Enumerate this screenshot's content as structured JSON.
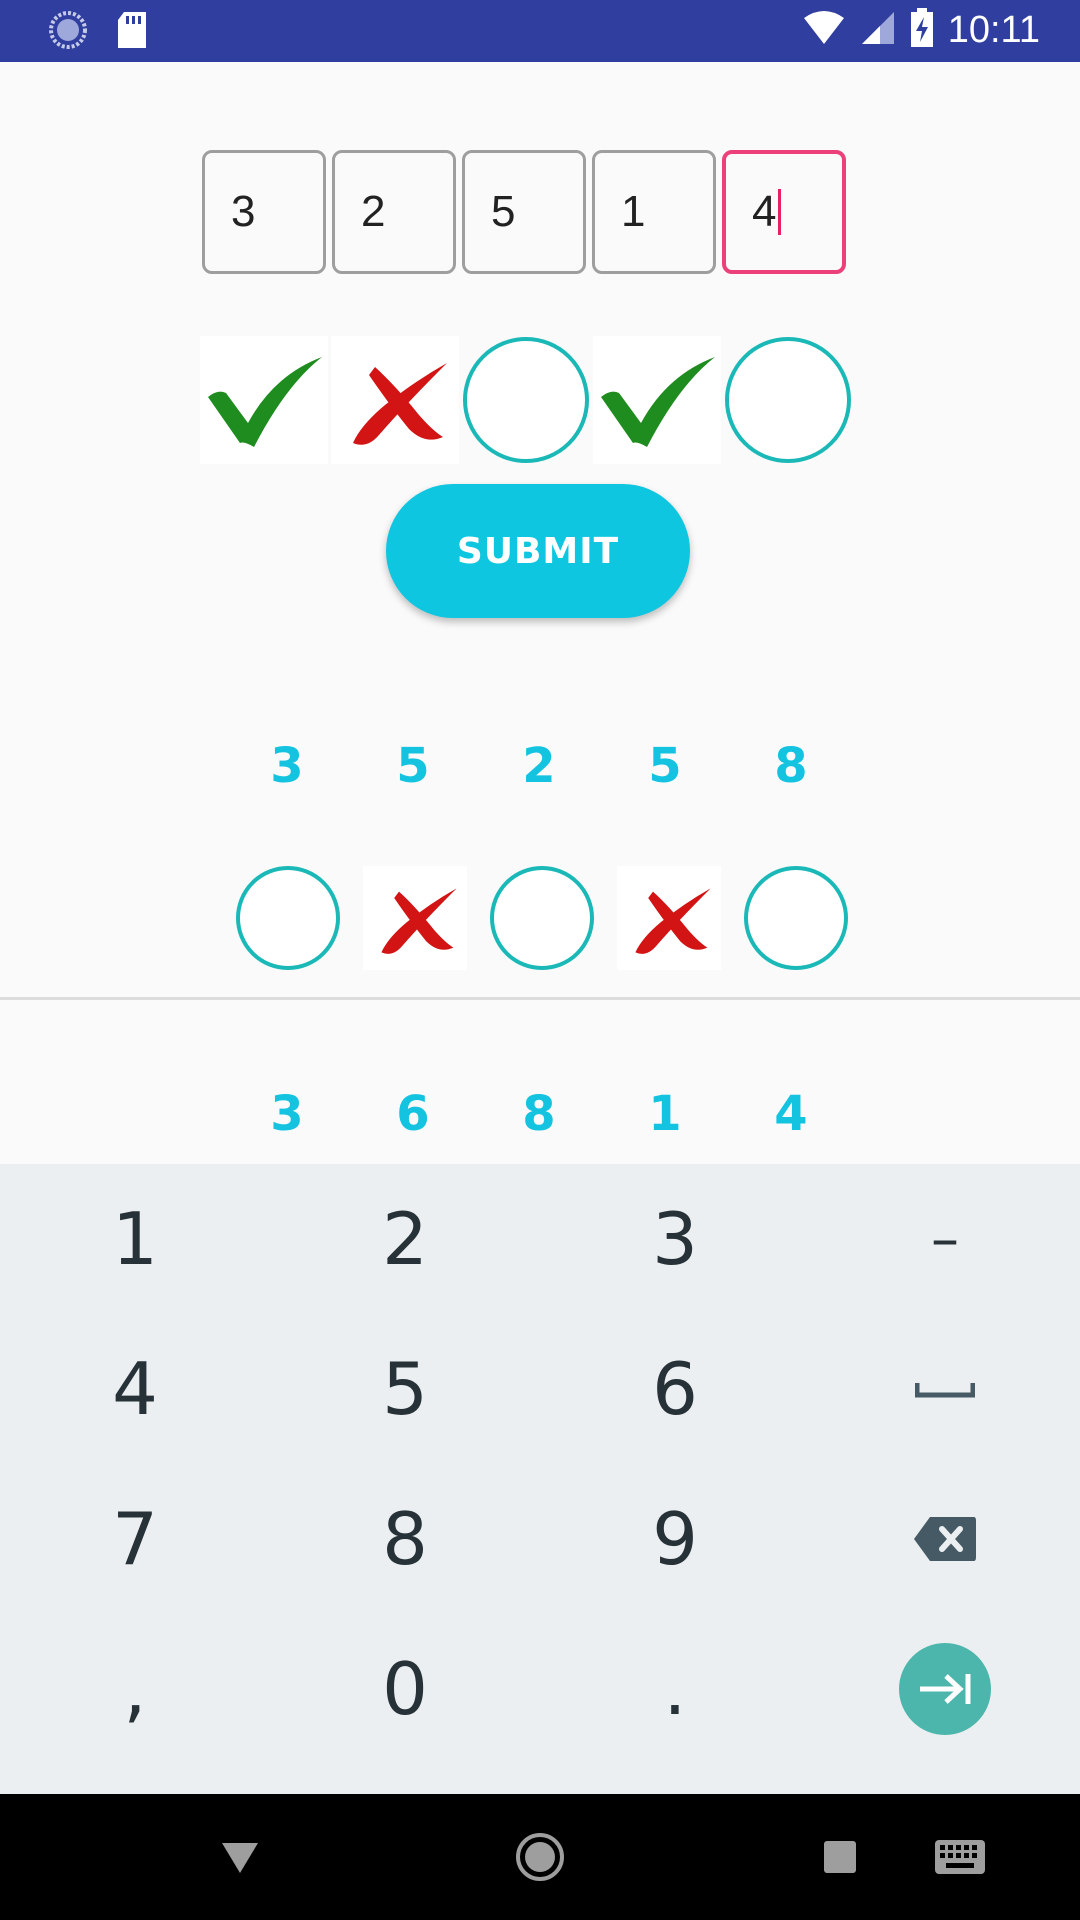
{
  "status_bar": {
    "time": "10:11",
    "icons": [
      "sync-icon",
      "sd-card-icon",
      "wifi-icon",
      "signal-icon",
      "battery-charging-icon"
    ]
  },
  "inputs": {
    "digits": [
      "3",
      "2",
      "5",
      "1",
      "4"
    ],
    "active_index": 4
  },
  "result_row_1": [
    "check",
    "cross",
    "circle",
    "check",
    "circle"
  ],
  "submit": {
    "label": "SUBMIT"
  },
  "guess_1": {
    "digits": [
      "3",
      "5",
      "2",
      "5",
      "8"
    ],
    "results": [
      "circle",
      "cross",
      "circle",
      "cross",
      "circle"
    ]
  },
  "guess_2": {
    "digits": [
      "3",
      "6",
      "8",
      "1",
      "4"
    ]
  },
  "keyboard": {
    "rows": [
      [
        "1",
        "2",
        "3",
        "–"
      ],
      [
        "4",
        "5",
        "6",
        "space"
      ],
      [
        "7",
        "8",
        "9",
        "backspace"
      ],
      [
        ",",
        "0",
        ".",
        "next"
      ]
    ]
  },
  "nav_bar": {
    "icons": [
      "back-icon",
      "home-icon",
      "recents-icon",
      "keyboard-icon"
    ]
  },
  "colors": {
    "accent": "#0fc6e0",
    "check": "#1e8c1e",
    "cross": "#d21414",
    "circle": "#1bb8b8",
    "active_border": "#ec407a"
  }
}
